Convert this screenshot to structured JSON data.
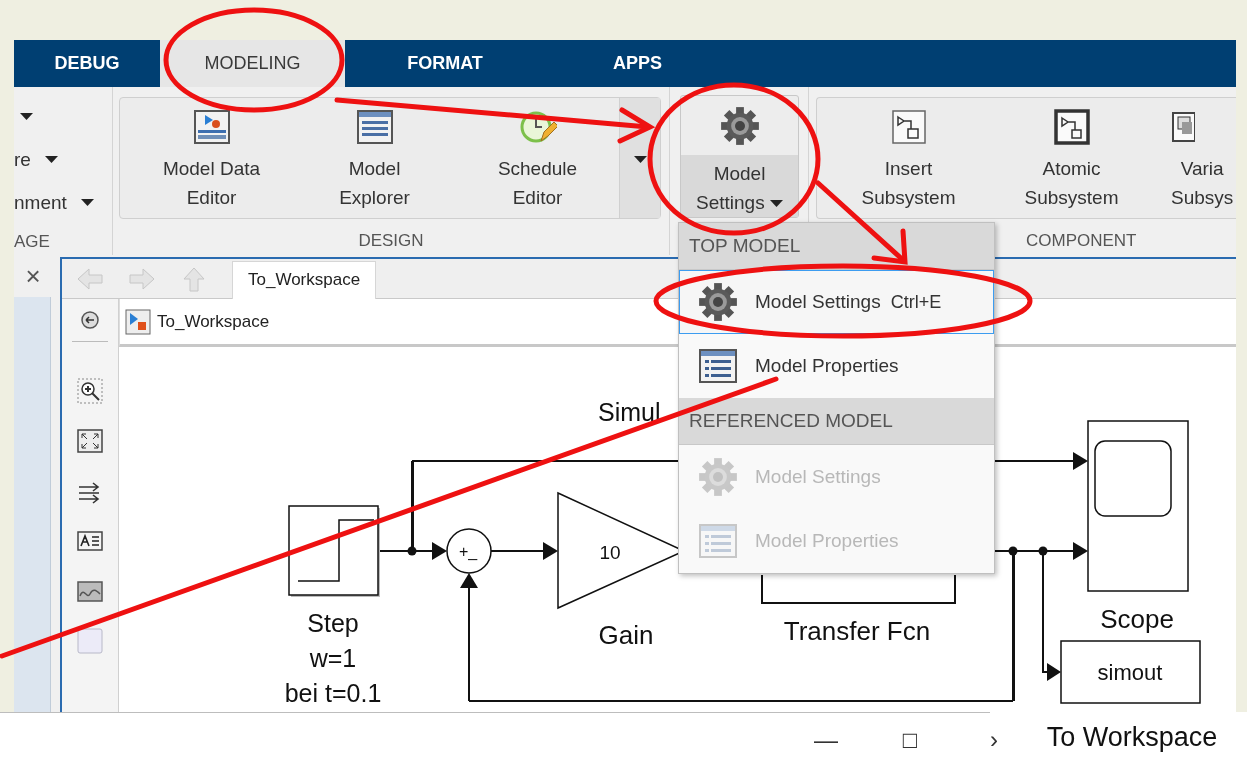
{
  "tabs": [
    {
      "label": "DEBUG",
      "selected": false
    },
    {
      "label": "MODELING",
      "selected": true
    },
    {
      "label": "FORMAT",
      "selected": false
    },
    {
      "label": "APPS",
      "selected": false
    }
  ],
  "ribbon": {
    "left_section": {
      "items": [
        "re",
        "nment"
      ],
      "title": "AGE"
    },
    "design": {
      "title": "DESIGN",
      "buttons": [
        {
          "kind": "data",
          "label": "Model Data\nEditor"
        },
        {
          "kind": "explorer",
          "label": "Model\nExplorer"
        },
        {
          "kind": "schedule",
          "label": "Schedule\nEditor"
        }
      ]
    },
    "model_settings": {
      "label": "Model\nSettings"
    },
    "component": {
      "title": "COMPONENT",
      "buttons": [
        {
          "kind": "insert",
          "label": "Insert\nSubsystem"
        },
        {
          "kind": "atomic",
          "label": "Atomic\nSubsystem"
        },
        {
          "kind": "variant",
          "label": "Varia\nSubsys"
        }
      ]
    }
  },
  "editor": {
    "close": "×",
    "tab": "To_Workspace",
    "breadcrumb": "To_Workspace"
  },
  "diagram": {
    "title": "Simul",
    "step": {
      "label": [
        "Step",
        "w=1",
        "bei t=0.1"
      ]
    },
    "sum": {
      "signs": "+_"
    },
    "gain": {
      "value": "10",
      "label": "Gain"
    },
    "transfer_fcn": {
      "label": "Transfer Fcn"
    },
    "scope": {
      "label": "Scope"
    },
    "to_workspace": {
      "value": "simout",
      "label": "To Workspace"
    }
  },
  "menu": {
    "sections": [
      {
        "header": "TOP MODEL",
        "items": [
          {
            "kind": "settings",
            "label": "Model Settings",
            "shortcut": "Ctrl+E",
            "selected": true,
            "disabled": false
          },
          {
            "kind": "properties",
            "label": "Model Properties",
            "selected": false,
            "disabled": false
          }
        ]
      },
      {
        "header": "REFERENCED MODEL",
        "items": [
          {
            "kind": "settings",
            "label": "Model Settings",
            "selected": false,
            "disabled": true
          },
          {
            "kind": "properties",
            "label": "Model Properties",
            "selected": false,
            "disabled": true
          }
        ]
      }
    ]
  },
  "window_controls": [
    "—",
    "□",
    "›"
  ]
}
